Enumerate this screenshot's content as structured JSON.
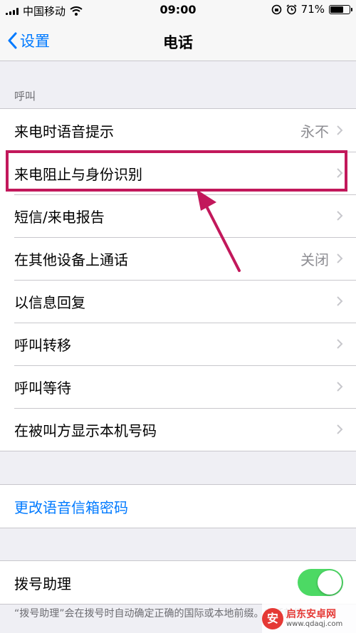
{
  "status_bar": {
    "carrier": "中国移动",
    "time": "09:00",
    "battery_percent": "71%",
    "battery_level": 0.71
  },
  "nav": {
    "back_label": "设置",
    "title": "电话"
  },
  "calls_section": {
    "header": "呼叫",
    "rows": [
      {
        "label": "来电时语音提示",
        "value": "永不"
      },
      {
        "label": "来电阻止与身份识别",
        "value": ""
      },
      {
        "label": "短信/来电报告",
        "value": ""
      },
      {
        "label": "在其他设备上通话",
        "value": "关闭"
      },
      {
        "label": "以信息回复",
        "value": ""
      },
      {
        "label": "呼叫转移",
        "value": ""
      },
      {
        "label": "呼叫等待",
        "value": ""
      },
      {
        "label": "在被叫方显示本机号码",
        "value": ""
      }
    ]
  },
  "voicemail": {
    "label": "更改语音信箱密码"
  },
  "dial_assist": {
    "label": "拨号助理",
    "enabled": true,
    "footer": "“拨号助理”会在拨号时自动确定正确的国际或本地前缀。电话前缀"
  },
  "watermark": {
    "name": "启东安卓网",
    "url": "www.qdaqj.com"
  },
  "colors": {
    "accent": "#007aff",
    "toggle_on": "#4cd964",
    "highlight": "#c2185b"
  }
}
